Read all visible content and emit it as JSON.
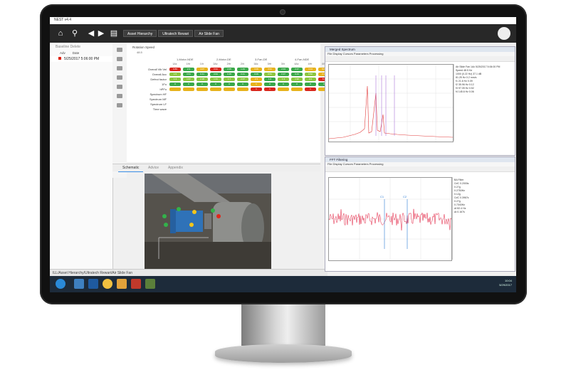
{
  "app": {
    "title": "NEST v4.4",
    "breadcrumbs": [
      "Asset Hierarchy",
      "Ultratech Rewari",
      "Air Slide Fan"
    ],
    "status_bar": "ILL/Asset Hierarchy/Ultratech Rewari/Air Slide Fan"
  },
  "baseline": {
    "tabs": "Baseline   Delete",
    "columns": [
      "Adv",
      "Date"
    ],
    "selected_date": "5/25/2017 5:06:00 PM"
  },
  "matrix": {
    "title": "Rotation Speed",
    "subtitle": "48.5",
    "groups": [
      "1-Motor-NDE",
      "2-Motor-DE",
      "3-Fan-DE",
      "4-Fan-NDE"
    ],
    "axes": [
      "1Ax",
      "1Hr",
      "1Vr",
      "2Ax",
      "2Hr",
      "2Vr",
      "3Ax",
      "3Hr",
      "3Vr",
      "4Ax",
      "4Hr",
      "4Vr"
    ],
    "rows": [
      {
        "label": "Overall Vib Vel",
        "values": [
          "0.83",
          "2.3",
          "4.07",
          "0.91",
          "2.05",
          "1.43",
          "3.06",
          "3.91",
          "2.04",
          "2.47",
          "4.14",
          "6.09"
        ],
        "colors": [
          "#d9261c",
          "#3aa84a",
          "#e7b21c",
          "#d9261c",
          "#3aa84a",
          "#3aa84a",
          "#e7b21c",
          "#e7b21c",
          "#3aa84a",
          "#3aa84a",
          "#e7b21c",
          "#e7b21c"
        ]
      },
      {
        "label": "Overall Acc",
        "values": [
          "1.5",
          "0.61",
          "0.41",
          "0.64",
          "0.45",
          "0.41",
          "0.09",
          "0.51",
          "0.37",
          "0.43",
          "0.52",
          "2.27"
        ],
        "colors": [
          "#8cc63f",
          "#3aa84a",
          "#3aa84a",
          "#3aa84a",
          "#3aa84a",
          "#3aa84a",
          "#3aa84a",
          "#8cc63f",
          "#3aa84a",
          "#3aa84a",
          "#8cc63f",
          "#e7b21c"
        ]
      },
      {
        "label": "Defect factor",
        "values": [
          "1.3",
          "1.67",
          "2.18",
          "1.31",
          "1.7",
          "2.07",
          "2.3",
          "1.6",
          "1.3",
          "1.92",
          "2.2",
          "6.1"
        ],
        "colors": [
          "#8cc63f",
          "#8cc63f",
          "#8cc63f",
          "#8cc63f",
          "#8cc63f",
          "#8cc63f",
          "#e7b21c",
          "#3aa84a",
          "#8cc63f",
          "#8cc63f",
          "#8cc63f",
          "#d9261c"
        ]
      },
      {
        "label": "1Fo",
        "values": [
          "0",
          "0",
          "0",
          "0",
          "0",
          "0",
          "1",
          "0",
          "0",
          "0",
          "0",
          "0"
        ],
        "colors": [
          "#3aa84a",
          "#3aa84a",
          "#3aa84a",
          "#3aa84a",
          "#3aa84a",
          "#3aa84a",
          "#e7b21c",
          "#3aa84a",
          "#3aa84a",
          "#3aa84a",
          "#3aa84a",
          "#3aa84a"
        ]
      },
      {
        "label": "hPFo",
        "values": [
          "",
          "",
          "",
          "",
          "",
          "",
          "1",
          "1",
          "",
          "",
          "1",
          ""
        ],
        "colors": [
          "#e7b21c",
          "#e7b21c",
          "#e7b21c",
          "#e7b21c",
          "#e7b21c",
          "#e7b21c",
          "#d9261c",
          "#d9261c",
          "#e7b21c",
          "#e7b21c",
          "#d9261c",
          "#e7b21c"
        ]
      }
    ],
    "extra_rows": [
      "Spectrum HF",
      "Spectrum MF",
      "Spectrum LF",
      "Time wave"
    ]
  },
  "tabs": [
    "Schematic",
    "Advice",
    "Appendix"
  ],
  "windows": {
    "merged": {
      "title": "Merged Spectrum",
      "menu": "File  Display  Cursors  Parameters  Processing"
    },
    "filtering": {
      "title": "FFT Filtering",
      "menu": "File  Display  Cursors  Parameters  Processing"
    }
  },
  "spectrum_legend": [
    "Air Slide Fan 1Ax 5/25/2017 5:06:00 PM",
    "Speed 48.5 Hz",
    "1000 (0.22 Hz) 37.1 dB",
    "81.25 Hz 0.2 mm/s",
    "f1 21.6 Hz 0.09",
    "f2 35.96 Hz 0.12",
    "f3 97.05 Hz 0.52",
    "f4 145.6 Hz 0.06"
  ],
  "filter_legend": [
    "BA Filter",
    "CdC 0.2000s",
    "0.27g",
    "0.2750Hz",
    "0.12g",
    "CdC 0.3967s",
    "0.27g",
    "0.7040Hz",
    "Δf 82.4 Hz",
    "Δt 0.167s"
  ],
  "taskbar": {
    "time": "10:04",
    "date": "5/29/2017"
  }
}
